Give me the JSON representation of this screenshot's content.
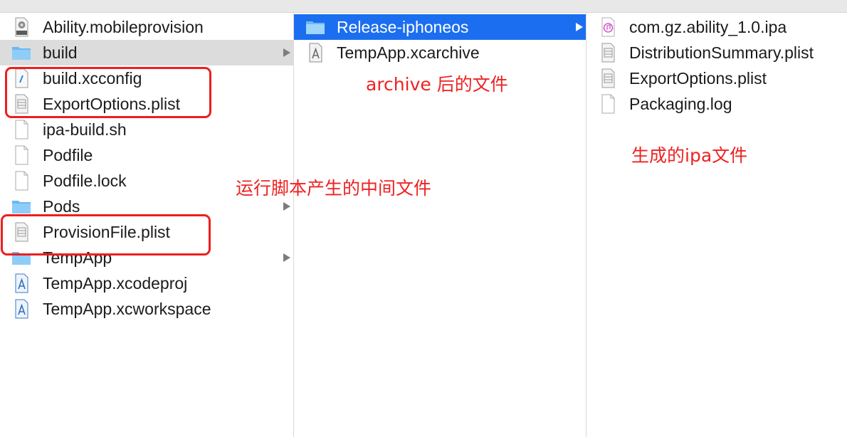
{
  "column1": {
    "items": [
      {
        "label": "Ability.mobileprovision",
        "icon": "provision-file-icon"
      },
      {
        "label": "build",
        "icon": "folder-icon"
      },
      {
        "label": "build.xcconfig",
        "icon": "xcconfig-file-icon"
      },
      {
        "label": "ExportOptions.plist",
        "icon": "plist-file-icon"
      },
      {
        "label": "ipa-build.sh",
        "icon": "document-icon"
      },
      {
        "label": "Podfile",
        "icon": "document-icon"
      },
      {
        "label": "Podfile.lock",
        "icon": "document-icon"
      },
      {
        "label": "Pods",
        "icon": "folder-icon"
      },
      {
        "label": "ProvisionFile.plist",
        "icon": "plist-file-icon"
      },
      {
        "label": "TempApp",
        "icon": "folder-icon"
      },
      {
        "label": "TempApp.xcodeproj",
        "icon": "xcode-project-icon"
      },
      {
        "label": "TempApp.xcworkspace",
        "icon": "xcode-workspace-icon"
      }
    ]
  },
  "column2": {
    "items": [
      {
        "label": "Release-iphoneos",
        "icon": "folder-icon"
      },
      {
        "label": "TempApp.xcarchive",
        "icon": "xcarchive-icon"
      }
    ]
  },
  "column3": {
    "items": [
      {
        "label": "com.gz.ability_1.0.ipa",
        "icon": "ipa-file-icon"
      },
      {
        "label": "DistributionSummary.plist",
        "icon": "plist-file-icon"
      },
      {
        "label": "ExportOptions.plist",
        "icon": "plist-file-icon"
      },
      {
        "label": "Packaging.log",
        "icon": "document-icon"
      }
    ]
  },
  "annotations": {
    "archive_note": "archive 后的文件",
    "script_note": "运行脚本产生的中间文件",
    "ipa_note": "生成的ipa文件"
  },
  "colors": {
    "selection": "#1c6ef0",
    "annotation_red": "#ee1e1e",
    "folder_blue": "#7cc4f5"
  }
}
